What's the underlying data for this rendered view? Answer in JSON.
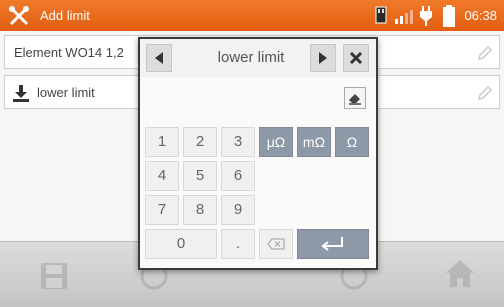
{
  "titlebar": {
    "title": "Add limit",
    "time": "06:38",
    "accent": "#e8641a"
  },
  "rows": [
    {
      "label": "Element WO14 1,2"
    },
    {
      "label": "lower limit"
    }
  ],
  "dialog": {
    "title": "lower limit",
    "keys": {
      "k1": "1",
      "k2": "2",
      "k3": "3",
      "k4": "4",
      "k5": "5",
      "k6": "6",
      "k7": "7",
      "k8": "8",
      "k9": "9",
      "k0": "0",
      "dot": ".",
      "micro": "μΩ",
      "milli": "mΩ",
      "ohm": "Ω"
    }
  },
  "icons": {
    "app": "wrench-screwdriver-icon",
    "sd_card": "sd-card-icon",
    "signal": "signal-icon",
    "plug": "plug-icon",
    "battery": "battery-icon",
    "save": "save-icon",
    "home": "home-icon"
  }
}
